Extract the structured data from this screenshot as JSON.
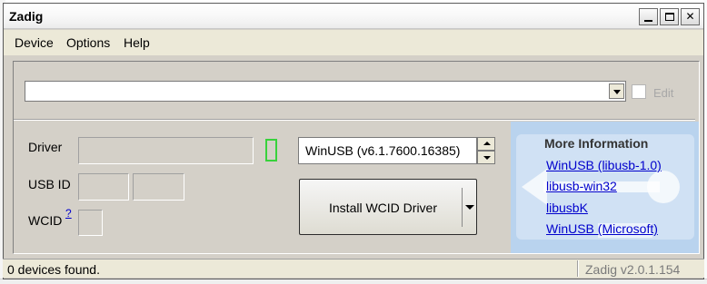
{
  "window": {
    "title": "Zadig",
    "title_buttons": [
      "minimize-icon",
      "maximize-icon",
      "close-icon"
    ]
  },
  "menu": {
    "device": "Device",
    "options": "Options",
    "help": "Help"
  },
  "device_select": {
    "value": "",
    "edit_label": "Edit",
    "edit_checked": false
  },
  "fields": {
    "driver_label": "Driver",
    "usb_id_label": "USB ID",
    "wcid_label": "WCID",
    "wcid_help": "?",
    "driver_current": "",
    "usb_vid": "",
    "usb_pid": "",
    "wcid_value": ""
  },
  "target_driver": {
    "value": "WinUSB (v6.1.7600.16385)"
  },
  "install_button": {
    "label": "Install WCID Driver"
  },
  "more_info": {
    "title": "More Information",
    "links": [
      "WinUSB (libusb-1.0)",
      "libusb-win32",
      "libusbK",
      "WinUSB (Microsoft)"
    ]
  },
  "status": {
    "message": "0 devices found.",
    "version": "Zadig v2.0.1.154"
  },
  "colors": {
    "window_bg": "#d4d0c8",
    "link": "#0000cc",
    "info_panel": "#b9d3ee",
    "indicator": "#38d23c"
  }
}
